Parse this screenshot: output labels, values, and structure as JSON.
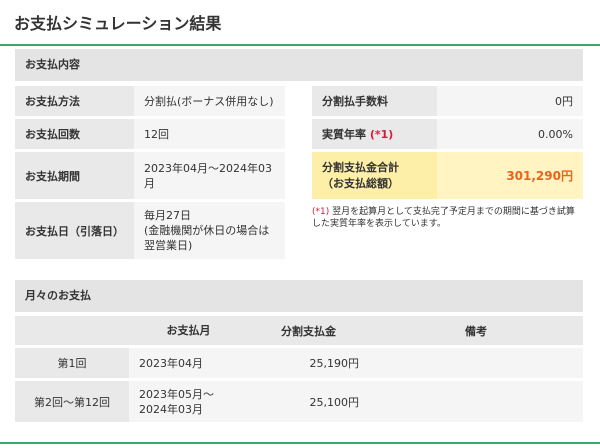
{
  "page": {
    "title": "お支払シミュレーション結果"
  },
  "summary": {
    "heading": "お支払内容",
    "rows": [
      {
        "label": "お支払方法",
        "value": "分割払(ボーナス併用なし)"
      },
      {
        "label": "お支払回数",
        "value": "12回"
      },
      {
        "label": "お支払期間",
        "value": "2023年04月～2024年03月"
      },
      {
        "label": "お支払日（引落日）",
        "value": "毎月27日\n(金融機関が休日の場合は翌営業日)"
      }
    ],
    "fee": {
      "label": "分割払手数料",
      "value": "0円"
    },
    "apr": {
      "label": "実質年率",
      "mark": "(*1)",
      "value": "0.00%"
    },
    "total": {
      "label": "分割支払金合計\n（お支払総額）",
      "value": "301,290円"
    },
    "footnote": {
      "mark": "(*1)",
      "text": "翌月を起算月として支払完了予定月までの期間に基づき試算した実質年率を表示しています。"
    }
  },
  "monthly": {
    "heading": "月々のお支払",
    "columns": [
      "",
      "お支払月",
      "分割支払金",
      "備考"
    ],
    "rows": [
      {
        "no": "第1回",
        "month": "2023年04月",
        "amount": "25,190円",
        "note": ""
      },
      {
        "no": "第2回～第12回",
        "month": "2023年05月～\n2024年03月",
        "amount": "25,100円",
        "note": ""
      }
    ]
  },
  "colors": {
    "accent_green": "#3aaa6a",
    "total_orange": "#e8651e",
    "note_red": "#d0213b",
    "total_bg": "#fff4c2"
  }
}
